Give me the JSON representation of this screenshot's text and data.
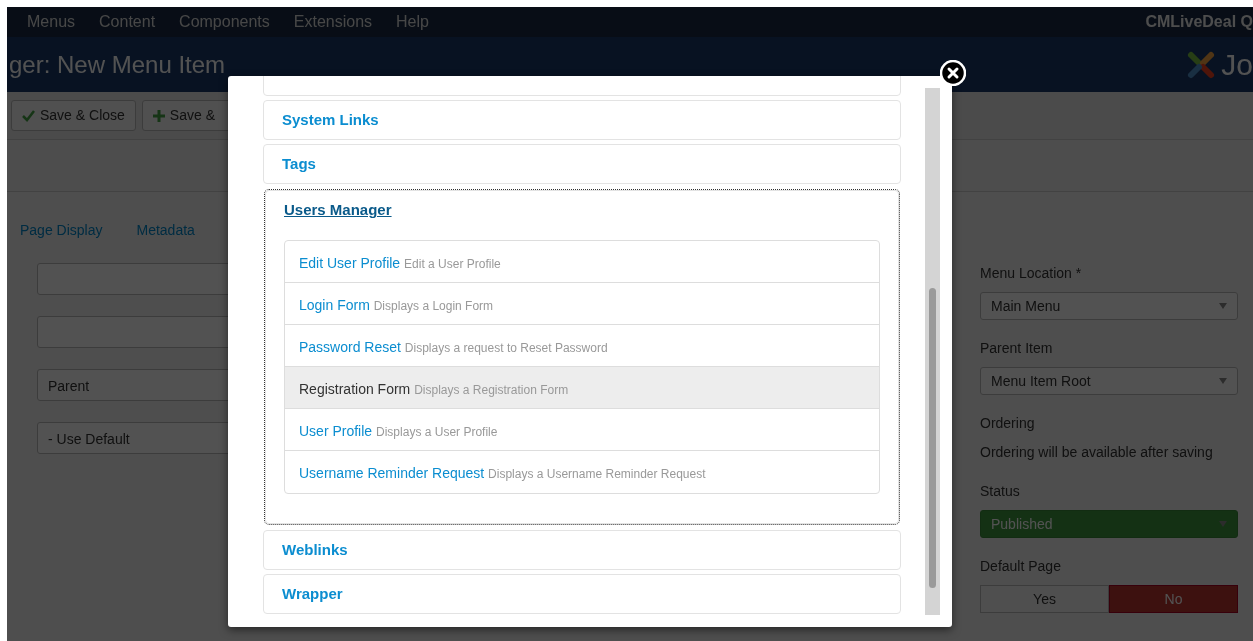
{
  "top_menu": {
    "items": [
      "Menus",
      "Content",
      "Components",
      "Extensions",
      "Help"
    ],
    "site_name": "CMLiveDeal Q"
  },
  "header": {
    "title": "ger: New Menu Item",
    "logo_text": "Jo"
  },
  "toolbar": {
    "buttons": [
      {
        "label": "Save & Close"
      },
      {
        "label": "Save &"
      }
    ]
  },
  "tabs": [
    {
      "label": "Page Display"
    },
    {
      "label": "Metadata"
    }
  ],
  "left_fields": [
    {
      "value": "Parent"
    },
    {
      "value": "- Use Default"
    }
  ],
  "side_fields": [
    {
      "kind": "select",
      "label": "Menu Location *",
      "value": "Main Menu"
    },
    {
      "kind": "select",
      "label": "Parent Item",
      "value": "Menu Item Root"
    },
    {
      "kind": "text",
      "label": "Ordering",
      "value": "Ordering will be available after saving"
    },
    {
      "kind": "status",
      "label": "Status",
      "value": "Published"
    },
    {
      "kind": "toggle",
      "label": "Default Page",
      "options": [
        {
          "label": "Yes",
          "selected": false
        },
        {
          "label": "No",
          "selected": true
        }
      ]
    }
  ],
  "modal": {
    "groups": [
      {
        "title": "System Links",
        "expanded": false
      },
      {
        "title": "Tags",
        "expanded": false
      },
      {
        "title": "Users Manager",
        "expanded": true,
        "items": [
          {
            "title": "Edit User Profile",
            "description": "Edit a User Profile",
            "selected": false
          },
          {
            "title": "Login Form",
            "description": "Displays a Login Form",
            "selected": false
          },
          {
            "title": "Password Reset",
            "description": "Displays a request to Reset Password",
            "selected": false
          },
          {
            "title": "Registration Form",
            "description": "Displays a Registration Form",
            "selected": true
          },
          {
            "title": "User Profile",
            "description": "Displays a User Profile",
            "selected": false
          },
          {
            "title": "Username Reminder Request",
            "description": "Displays a Username Reminder Request",
            "selected": false
          }
        ]
      },
      {
        "title": "Weblinks",
        "expanded": false
      },
      {
        "title": "Wrapper",
        "expanded": false
      }
    ]
  }
}
